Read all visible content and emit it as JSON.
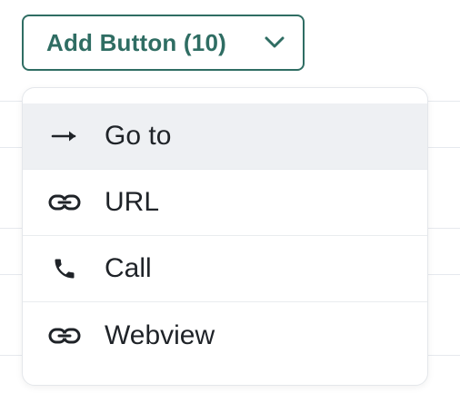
{
  "add_button": {
    "label": "Add Button (10)",
    "icon": "chevron-down-icon"
  },
  "menu": {
    "items": [
      {
        "label": "Go to",
        "icon": "arrow-right-icon",
        "active": true
      },
      {
        "label": "URL",
        "icon": "link-icon",
        "active": false
      },
      {
        "label": "Call",
        "icon": "phone-icon",
        "active": false
      },
      {
        "label": "Webview",
        "icon": "link-icon",
        "active": false
      }
    ]
  },
  "colors": {
    "accent": "#2f6d63",
    "active_bg": "#eef0f3",
    "text": "#1f2328"
  }
}
